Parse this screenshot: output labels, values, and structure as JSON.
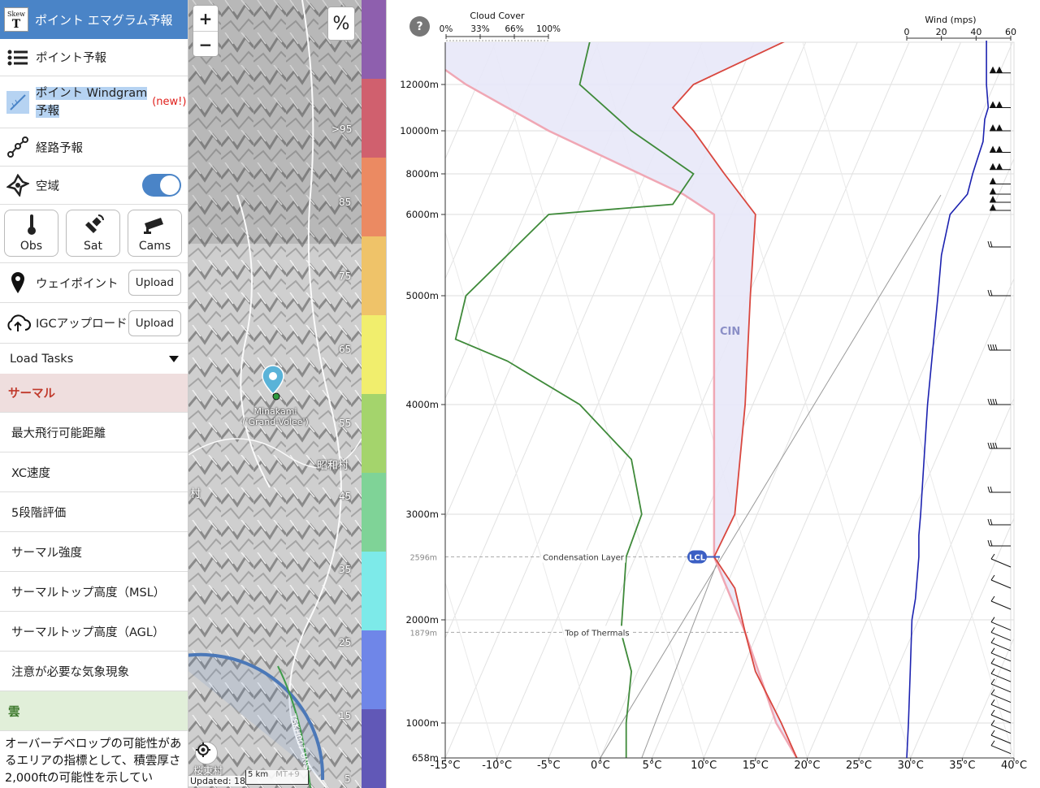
{
  "sidebar": {
    "app_title": "ポイント エマグラム予報",
    "logo_top": "Skew",
    "logo_bottom": "T",
    "point_forecast": "ポイント予報",
    "windgram_line1": "ポイント Windgram",
    "windgram_line2": "予報",
    "new_badge": "(new!)",
    "route_forecast": "経路予報",
    "airspace": "空域",
    "airspace_enabled": true,
    "tiles": [
      {
        "label": "Obs",
        "icon": "thermometer-icon"
      },
      {
        "label": "Sat",
        "icon": "satellite-icon"
      },
      {
        "label": "Cams",
        "icon": "camera-icon"
      }
    ],
    "waypoint_label": "ウェイポイント",
    "waypoint_upload": "Upload",
    "igc_label": "IGCアップロード",
    "igc_upload": "Upload",
    "load_tasks": "Load Tasks",
    "section_thermal": "サーマル",
    "thermal_items": [
      "最大飛行可能距離",
      "XC速度",
      "5段階評価",
      "サーマル強度",
      "サーマルトップ高度（MSL）",
      "サーマルトップ高度（AGL）",
      "注意が必要な気象現象"
    ],
    "section_cloud": "雲",
    "description": "オーバーデベロップの可能性があるエリアの指標として、積雲厚さ2,000ftの可能性を示してい"
  },
  "map": {
    "zoom_in": "+",
    "zoom_out": "−",
    "percent_button": "%",
    "contour_labels": [
      ">95",
      "85",
      "75",
      "65",
      "55",
      "45",
      "35",
      "25",
      "15",
      "5"
    ],
    "station_name": "Minakami",
    "station_sub": "('Grand-Volee')",
    "village": "昭和村",
    "edge_text": "村",
    "updated": "Updated: 18",
    "scale": "5 km",
    "timezone_fragment": "MT+9",
    "bottom_town": "桜東村",
    "road_label": "TSKH007 UNSI"
  },
  "legend_colors": [
    "#8e5fae",
    "#d0606e",
    "#eb8a62",
    "#efc369",
    "#f1ee6d",
    "#a4d46c",
    "#7fd397",
    "#7deae9",
    "#6f86e8",
    "#6158b7"
  ],
  "chart": {
    "help_label": "?",
    "cloud_cover_title": "Cloud Cover",
    "cloud_cover_ticks": [
      "0%",
      "33%",
      "66%",
      "100%"
    ],
    "wind_title": "Wind (mps)",
    "wind_ticks": [
      "0",
      "20",
      "40",
      "60"
    ],
    "cin_label": "CIN",
    "lcl_label": "LCL",
    "condensation_label": "Condensation Layer",
    "condensation_alt": "2596m",
    "thermal_top_label": "Top of Thermals",
    "thermal_top_alt": "1879m",
    "colors": {
      "temperature": "#d9473f",
      "dewpoint": "#3f8a3a",
      "parcel": "#f0a7b4",
      "wind": "#1c22b0",
      "cin_fill": "#e8e8f8"
    }
  },
  "chart_data": {
    "type": "line",
    "title": "",
    "xlabel": "",
    "ylabel": "",
    "x_ticks": [
      "-15°C",
      "-10°C",
      "-5°C",
      "0°C",
      "5°C",
      "10°C",
      "15°C",
      "20°C",
      "25°C",
      "30°C",
      "35°C",
      "40°C"
    ],
    "xlim": [
      -15,
      40
    ],
    "y_ticks": [
      "658m",
      "1000m",
      "2000m",
      "3000m",
      "4000m",
      "5000m",
      "6000m",
      "8000m",
      "10000m",
      "12000m"
    ],
    "y_tick_values": [
      658,
      1000,
      2000,
      3000,
      4000,
      5000,
      6000,
      8000,
      10000,
      12000
    ],
    "series": [
      {
        "name": "",
        "key": "temperature",
        "points": [
          [
            19,
            658
          ],
          [
            17.5,
            1000
          ],
          [
            15,
            1500
          ],
          [
            14,
            1879
          ],
          [
            13,
            2300
          ],
          [
            11,
            2596
          ],
          [
            13,
            3000
          ],
          [
            14,
            4000
          ],
          [
            14.5,
            5000
          ],
          [
            15,
            6000
          ],
          [
            12,
            8000
          ],
          [
            9,
            10000
          ],
          [
            7,
            11000
          ],
          [
            9,
            12000
          ],
          [
            18,
            14000
          ]
        ]
      },
      {
        "name": "",
        "key": "dewpoint",
        "points": [
          [
            2.5,
            658
          ],
          [
            2.5,
            1000
          ],
          [
            3,
            1500
          ],
          [
            2,
            1879
          ],
          [
            2.5,
            2596
          ],
          [
            4,
            3000
          ],
          [
            3,
            3500
          ],
          [
            -2,
            4000
          ],
          [
            -9,
            4400
          ],
          [
            -14,
            4600
          ],
          [
            -13,
            5000
          ],
          [
            -5,
            6000
          ],
          [
            7,
            6500
          ],
          [
            9,
            8000
          ],
          [
            3,
            10000
          ],
          [
            -2,
            12000
          ],
          [
            -1,
            14000
          ]
        ]
      },
      {
        "name": "",
        "key": "parcel",
        "points": [
          [
            19,
            658
          ],
          [
            17,
            1000
          ],
          [
            14,
            1879
          ],
          [
            11,
            2596
          ],
          [
            11,
            4000
          ],
          [
            11,
            6000
          ],
          [
            8,
            7000
          ],
          [
            -5,
            10000
          ],
          [
            -13,
            12000
          ],
          [
            -19,
            14000
          ]
        ]
      }
    ],
    "cloud_cover_axis": [
      0,
      100
    ],
    "wind_axis": [
      0,
      60
    ],
    "wind_speed_mps": [
      0,
      1,
      2,
      3,
      5,
      7,
      7,
      8,
      10,
      12,
      15,
      18,
      20,
      25,
      30,
      35,
      38,
      40,
      44,
      45,
      47,
      46,
      46
    ],
    "wind_altitudes_m": [
      658,
      1000,
      1500,
      2000,
      2200,
      2596,
      2800,
      3000,
      3500,
      4000,
      4500,
      5000,
      5500,
      6000,
      6500,
      7000,
      8000,
      8500,
      9500,
      10500,
      11000,
      12000,
      14000
    ],
    "lcl_m": 2596,
    "thermal_top_m": 1879,
    "grid": true
  }
}
